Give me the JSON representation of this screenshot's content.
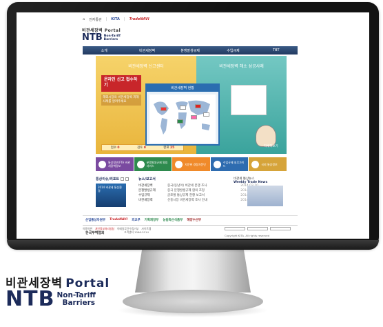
{
  "browser_topbar": {
    "home": "⌂",
    "links": [
      "전자통관",
      "KITA",
      "TradeNAVI"
    ]
  },
  "site_logo": {
    "korean": "비관세장벽 Portal",
    "ntb": "NTB",
    "line1": "Non-Tariff",
    "line2": "Barriers"
  },
  "nav": [
    "소개",
    "비관세장벽",
    "분쟁발생규제",
    "수입규제",
    "TBT"
  ],
  "hero": {
    "left_title": "비관세장벽 신고센터",
    "online_label": "온라인 신고 접수하기",
    "online_sub": "해외시장의 비관세장벽 피해사례를 알려주세요",
    "stats": [
      {
        "label": "접수",
        "value": "0"
      },
      {
        "label": "검토",
        "value": "0"
      },
      {
        "label": "완료",
        "value": "25"
      }
    ],
    "map_title": "비관세장벽 현황",
    "right_title": "비관세장벽 해소 성공사례",
    "right_caption": "자세히보기"
  },
  "quick_links": [
    "통상정보/FTA 비관세장벽정보",
    "분쟁발생규제 알림 서비스",
    "자문위 경장자문단",
    "수입규제 실무가이드",
    "국외 통상정보"
  ],
  "content": {
    "news_title": "통상이슈/리포트",
    "report_title": "뉴스/보고서",
    "thumb_text": "2014 비관세 통상환경",
    "categories": [
      "비관세장벽",
      "분쟁발생규제",
      "수입규제",
      "비관세장벽"
    ],
    "news_items": [
      {
        "title": "중국(동남아) 비관세 분쟁 조사",
        "date": "2014.03.10"
      },
      {
        "title": "중국 분쟁발생규제 합의 조정",
        "date": "2014.03.06"
      },
      {
        "title": "글로벌 통상규제 현황 보고서",
        "date": "2014.03.04"
      },
      {
        "title": "신흥시장 비관세장벽 조사 안내",
        "date": "2014.03.03"
      }
    ],
    "weekly_kr": "비관세 통상뉴스",
    "weekly_en": "Weekly Trade News"
  },
  "partners": [
    "산업통상자원부",
    "TradeNAVI",
    "외교부",
    "기획재정부",
    "농림축산식품부",
    "해양수산부"
  ],
  "footer": {
    "links": [
      "이용약관",
      "개인정보처리방침",
      "이메일무단수집거부",
      "사이트맵"
    ],
    "org": "한국무역협회",
    "addr": "고객센터 1566-5114",
    "copyright": "Copyright KITA. All rights reserved"
  },
  "brand_logo": {
    "korean": "비관세장벽",
    "portal": "Portal",
    "ntb": "NTB",
    "line1": "Non-Tariff",
    "line2": "Barriers"
  },
  "colors": {
    "navy": "#1c2b5a",
    "yellow": "#e9b53c",
    "teal": "#3aa39c",
    "red": "#c8262a"
  }
}
